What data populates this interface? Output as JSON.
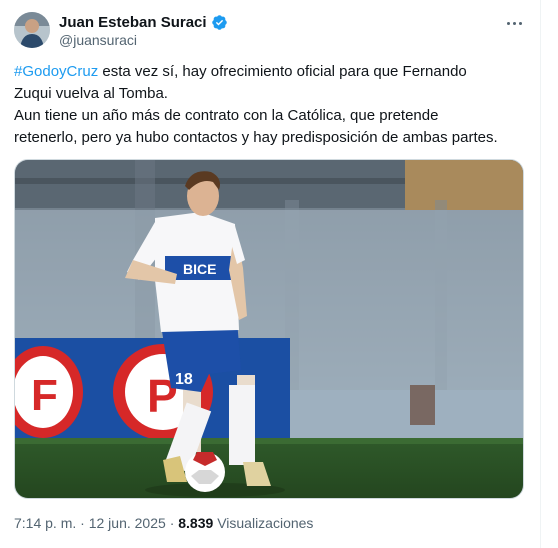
{
  "author": {
    "name": "Juan Esteban Suraci",
    "handle": "@juansuraci"
  },
  "tweet": {
    "hashtag": "#GodoyCruz",
    "line1_rest": " esta vez sí, hay ofrecimiento oficial para que Fernando",
    "line2": "Zuqui vuelva al Tomba.",
    "line3": "Aun tiene un año más de contrato con la Católica, que pretende",
    "line4": "retenerlo, pero ya hubo contactos y hay predisposición de ambas partes."
  },
  "media": {
    "jersey_sponsor": "BICE",
    "jersey_number": "18"
  },
  "meta": {
    "time": "7:14 p. m.",
    "separator": "·",
    "date": "12 jun. 2025",
    "views_count": "8.839",
    "views_label": "Visualizaciones"
  },
  "colors": {
    "accent": "#1d9bf0",
    "text": "#0f1419",
    "secondary": "#536471"
  },
  "icons": {
    "verified": "verified-badge-icon",
    "more": "more-options-icon"
  }
}
